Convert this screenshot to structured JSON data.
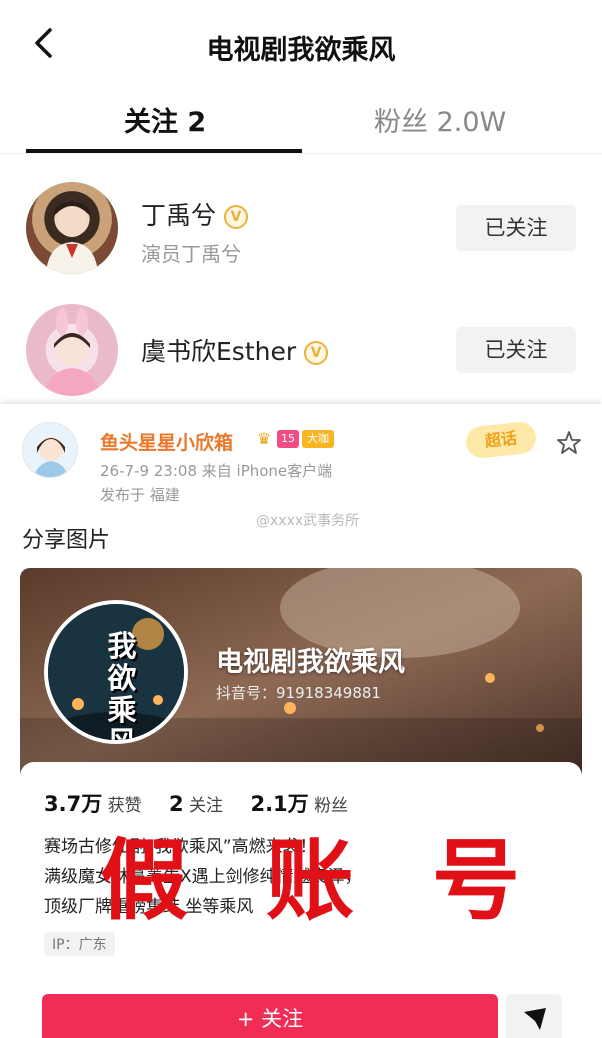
{
  "nav": {
    "title": "电视剧我欲乘风"
  },
  "tabs": {
    "follow": "关注 2",
    "fans": "粉丝 2.0W"
  },
  "users": [
    {
      "name": "丁禹兮",
      "subtitle": "演员丁禹兮",
      "verify": "V",
      "button": "已关注"
    },
    {
      "name": "虞书欣Esther",
      "subtitle": "",
      "verify": "V",
      "button": "已关注"
    }
  ],
  "weibo": {
    "name": "鱼头星星小欣箱",
    "level_badge": "15",
    "big_badge": "大咖",
    "meta": "26-7-9 23:08  来自 iPhone客户端",
    "location": "发布于 福建",
    "supertopic": "超话",
    "watermark": "@xxxx武事务所",
    "text": "分享图片"
  },
  "shared": {
    "poster_text": "我欲乘风",
    "name": "电视剧我欲乘风",
    "douyin_id": "抖音号：91918349881",
    "stats": {
      "likes_value": "3.7万",
      "likes_label": "获赞",
      "following_value": "2",
      "following_label": "关注",
      "fans_value": "2.1万",
      "fans_label": "粉丝"
    },
    "bio": [
      "赛场古修仙剧“我欲乘风”高燃来袭！",
      "满级魔女林蔓菁生X遇上剑修纯情越良泽，",
      "顶级厂牌重磅集结 坐等乘风"
    ],
    "ip": "IP：广东",
    "follow_button": "+ 关注"
  },
  "stamp": "假账号"
}
